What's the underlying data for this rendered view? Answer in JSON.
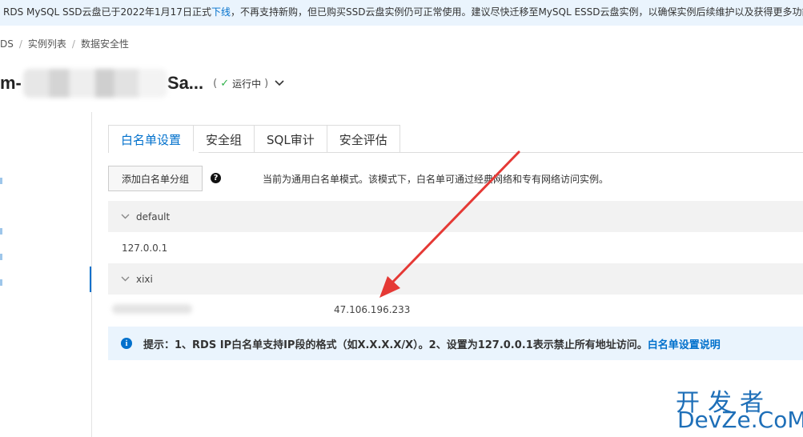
{
  "notice": {
    "text_before": "RDS MySQL SSD云盘已于2022年1月17日正式",
    "link": "下线",
    "text_after": "，不再支持新购，但已购买SSD云盘实例仍可正常使用。建议尽快迁移至MySQL ESSD云盘实例，以确保实例后续维护以及获得更多功能"
  },
  "breadcrumb": {
    "root": "DS",
    "item1": "实例列表",
    "current": "数据安全性"
  },
  "instance": {
    "name_prefix": "m-",
    "name_suffix": "Sa...",
    "status": "运行中",
    "paren_open": "(",
    "paren_close": ")"
  },
  "tabs": [
    {
      "label": "白名单设置",
      "active": true
    },
    {
      "label": "安全组",
      "active": false
    },
    {
      "label": "SQL审计",
      "active": false
    },
    {
      "label": "安全评估",
      "active": false
    }
  ],
  "whitelist": {
    "add_button": "添加白名单分组",
    "help_icon": "question-icon",
    "mode_text": "当前为通用白名单模式。该模式下，白名单可通过经典网络和专有网络访问实例。",
    "groups": [
      {
        "name": "default",
        "ips": "127.0.0.1"
      },
      {
        "name": "xixi",
        "ips": "47.106.196.233"
      }
    ]
  },
  "tip": {
    "text": "提示：1、RDS IP白名单支持IP段的格式（如X.X.X.X/X）。2、设置为127.0.0.1表示禁止所有地址访问。",
    "link": "白名单设置说明"
  },
  "watermark": {
    "cn": "开发者",
    "en": "DevZe.CoM"
  },
  "colors": {
    "accent": "#0070cc",
    "notice_bg": "#eaf4fd",
    "status_ok": "#2fb14a",
    "arrow": "#e53935"
  }
}
